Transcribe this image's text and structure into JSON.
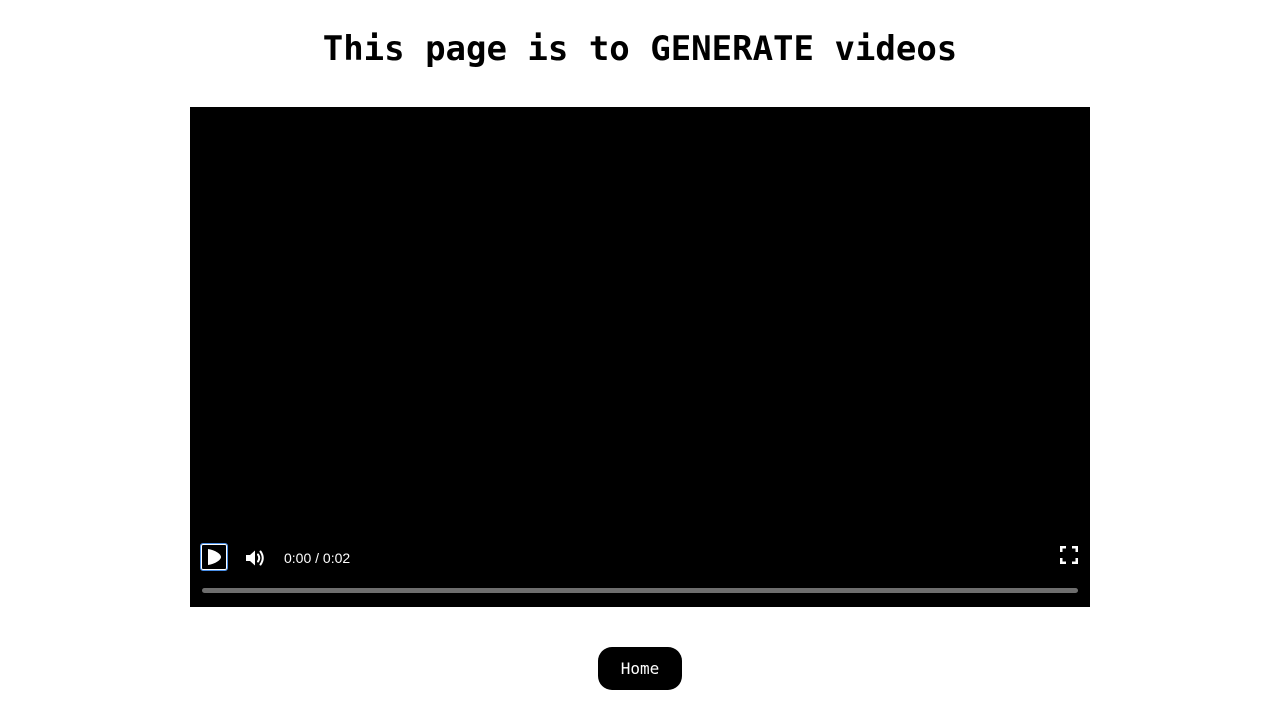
{
  "page": {
    "title": "This page is to GENERATE videos"
  },
  "video": {
    "time_display": "0:00 / 0:02",
    "progress": 0,
    "controls": {
      "play_icon": "play-icon",
      "mute_icon": "volume-icon",
      "fullscreen_icon": "fullscreen-icon"
    }
  },
  "nav": {
    "home_label": "Home"
  },
  "colors": {
    "background": "#ffffff",
    "player_background": "#000000",
    "focus_ring": "#4a8fe7",
    "progress_track": "#6e6e6e",
    "button_background": "#000000",
    "button_text": "#ffffff"
  }
}
